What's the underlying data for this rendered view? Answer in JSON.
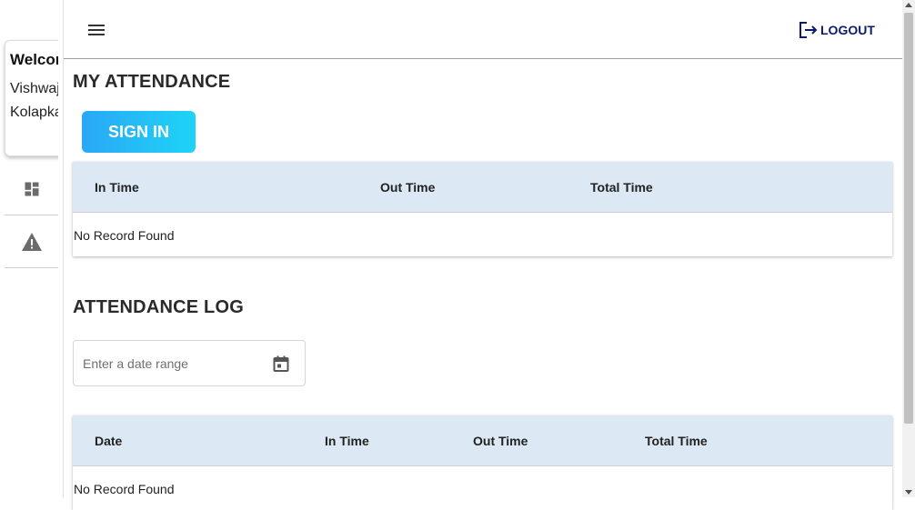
{
  "sidebar": {
    "welcome_title": "Welcome",
    "user_first": "Vishwajeet",
    "user_last": "Kolapkar",
    "nav": [
      {
        "icon": "dashboard-icon"
      },
      {
        "icon": "warning-icon"
      }
    ]
  },
  "header": {
    "menu_icon": "menu-icon",
    "logout_label": "LOGOUT",
    "logout_icon": "logout-icon"
  },
  "my_attendance": {
    "title": "MY ATTENDANCE",
    "signin_label": "SIGN IN",
    "columns": [
      "In Time",
      "Out Time",
      "Total Time"
    ],
    "empty_text": "No Record Found"
  },
  "attendance_log": {
    "title": "ATTENDANCE LOG",
    "date_placeholder": "Enter a date range",
    "calendar_icon": "calendar-icon",
    "columns": [
      "Date",
      "In Time",
      "Out Time",
      "Total Time"
    ],
    "empty_text": "No Record Found"
  },
  "colors": {
    "header_row": "#dce9f5",
    "signin_gradient_start": "#2aa7f6",
    "signin_gradient_end": "#1ed4f6",
    "logout": "#0d1b6e"
  }
}
